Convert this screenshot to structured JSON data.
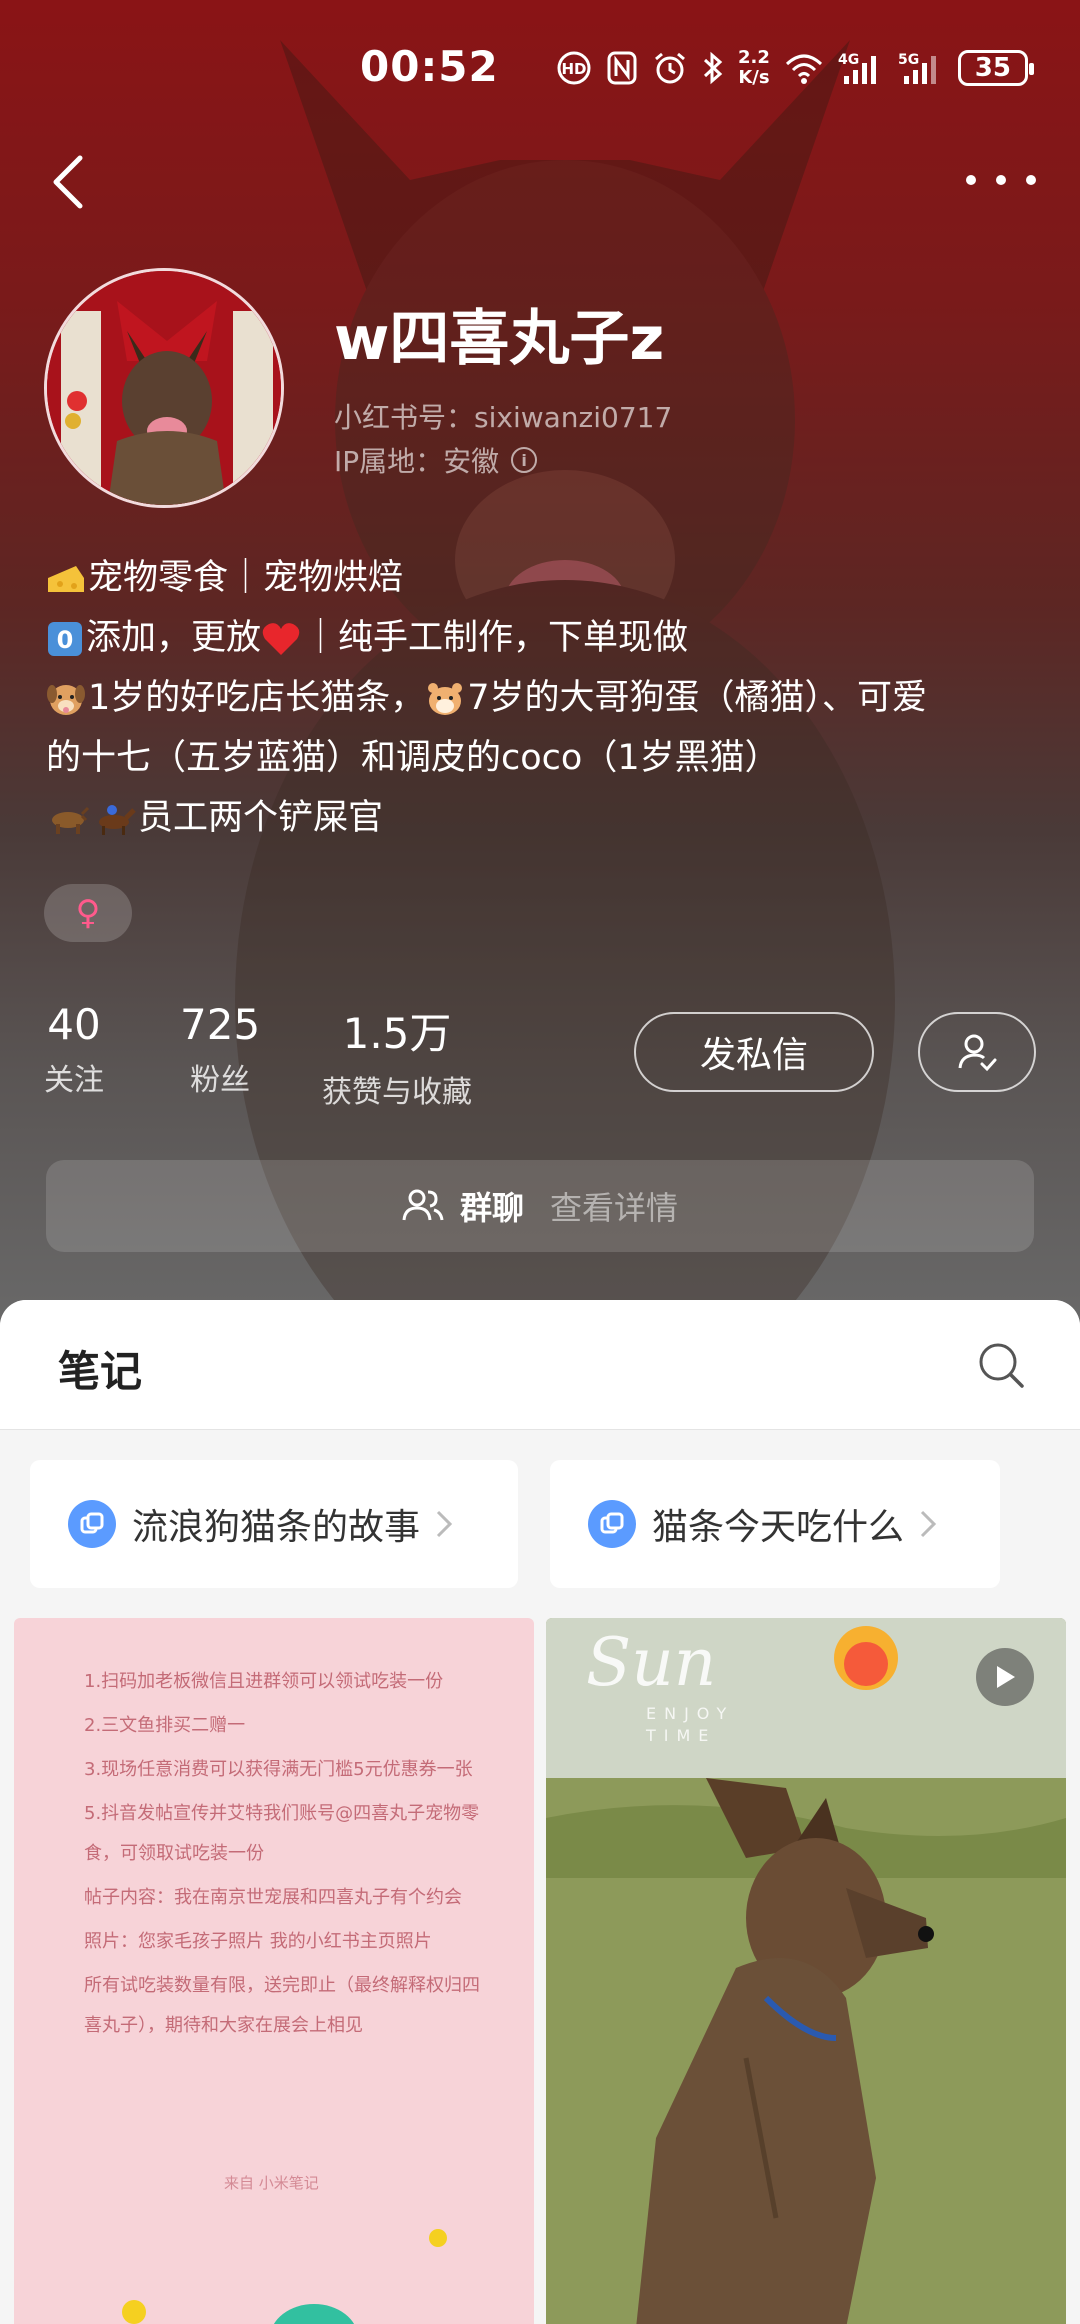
{
  "status_bar": {
    "time": "00:52",
    "net_speed_value": "2.2",
    "net_speed_unit": "K/s",
    "battery": "35"
  },
  "profile": {
    "username": "w四喜丸子z",
    "redbook_id": "小红书号：sixiwanzi0717",
    "ip_location": "IP属地：安徽",
    "bio_lines": [
      "宠物零食｜宠物烘焙",
      "添加，更放",
      "｜纯手工制作，下单现做",
      "1岁的好吃店长猫条，",
      "7岁的大哥狗蛋（橘猫）、可爱",
      "的十七（五岁蓝猫）和调皮的coco（1岁黑猫）",
      "员工两个铲屎官"
    ],
    "gender_symbol": "♀"
  },
  "stats": [
    {
      "value": "40",
      "label": "关注"
    },
    {
      "value": "725",
      "label": "粉丝"
    },
    {
      "value": "1.5万",
      "label": "获赞与收藏"
    }
  ],
  "actions": {
    "message_label": "发私信"
  },
  "group_chat": {
    "label": "群聊",
    "detail": "查看详情"
  },
  "notes": {
    "title": "笔记",
    "collections": [
      {
        "label": "流浪狗猫条的故事"
      },
      {
        "label": "猫条今天吃什么"
      }
    ],
    "note_card": {
      "lines": [
        "1.扫码加老板微信且进群领可以领试吃装一份",
        "2.三文鱼排买二赠一",
        "3.现场任意消费可以获得满无门槛5元优惠券一张",
        "5.抖音发帖宣传并艾特我们账号@四喜丸子宠物零食，可领取试吃装一份",
        "帖子内容：我在南京世宠展和四喜丸子有个约会",
        "照片：您家毛孩子照片 我的小红书主页照片",
        "所有试吃装数量有限，送完即止（最终解释权归四喜丸子），期待和大家在展会上相见"
      ],
      "footer": "来自 小米笔记"
    },
    "photo_card": {
      "watermark_script": "Sun",
      "watermark_line1": "ENJOY",
      "watermark_line2": "TIME"
    }
  },
  "colors": {
    "header_red": "#8a1416",
    "accent_blue": "#5b9bff",
    "note_pink": "#f7d3d8",
    "gender_pink": "#ff5a8c"
  }
}
